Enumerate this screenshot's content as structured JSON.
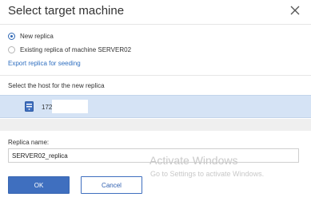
{
  "dialog": {
    "title": "Select target machine",
    "close_icon": "close-icon"
  },
  "options": {
    "new_replica": {
      "label": "New replica",
      "selected": true
    },
    "existing_replica": {
      "label": "Existing replica of machine SERVER02",
      "selected": false
    }
  },
  "links": {
    "export_replica": "Export replica for seeding"
  },
  "host_section": {
    "label": "Select the host for the new replica",
    "hosts": [
      {
        "icon": "server-icon",
        "address": "172."
      }
    ]
  },
  "replica": {
    "name_label": "Replica name:",
    "name_value": "SERVER02_replica"
  },
  "buttons": {
    "ok": "OK",
    "cancel": "Cancel"
  },
  "watermark": {
    "title": "Activate Windows",
    "subtitle": "Go to Settings to activate Windows."
  },
  "colors": {
    "accent": "#3f6fbf",
    "link": "#2f6fc0",
    "selected_row": "#d5e3f5"
  }
}
